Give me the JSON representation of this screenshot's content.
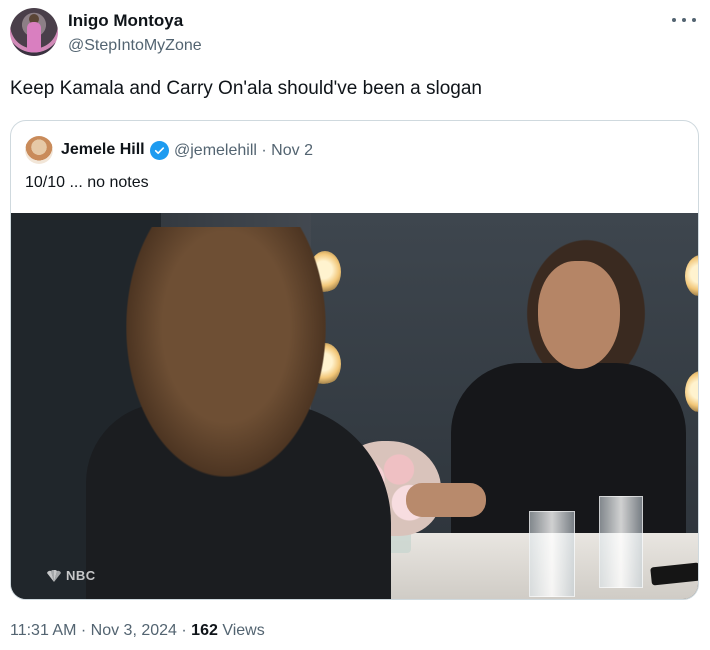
{
  "author": {
    "name": "Inigo Montoya",
    "handle": "@StepIntoMyZone",
    "avatar_icon": "avatar"
  },
  "tweet": {
    "text": "Keep Kamala and Carry On'ala should've been a slogan"
  },
  "quoted_tweet": {
    "name": "Jemele Hill",
    "handle": "@jemelehill",
    "separator": "·",
    "date": "Nov 2",
    "verified_icon": "verified-badge-icon",
    "verified_color": "#1d9bf0",
    "text": "10/10 ... no notes",
    "media": {
      "watermark": "NBC"
    }
  },
  "meta": {
    "time": "11:31 AM",
    "separator": "·",
    "date": "Nov 3, 2024",
    "views_count": "162",
    "views_label": "Views"
  },
  "colors": {
    "text_primary": "#0f1419",
    "text_secondary": "#536471",
    "border": "#cfd9de"
  }
}
